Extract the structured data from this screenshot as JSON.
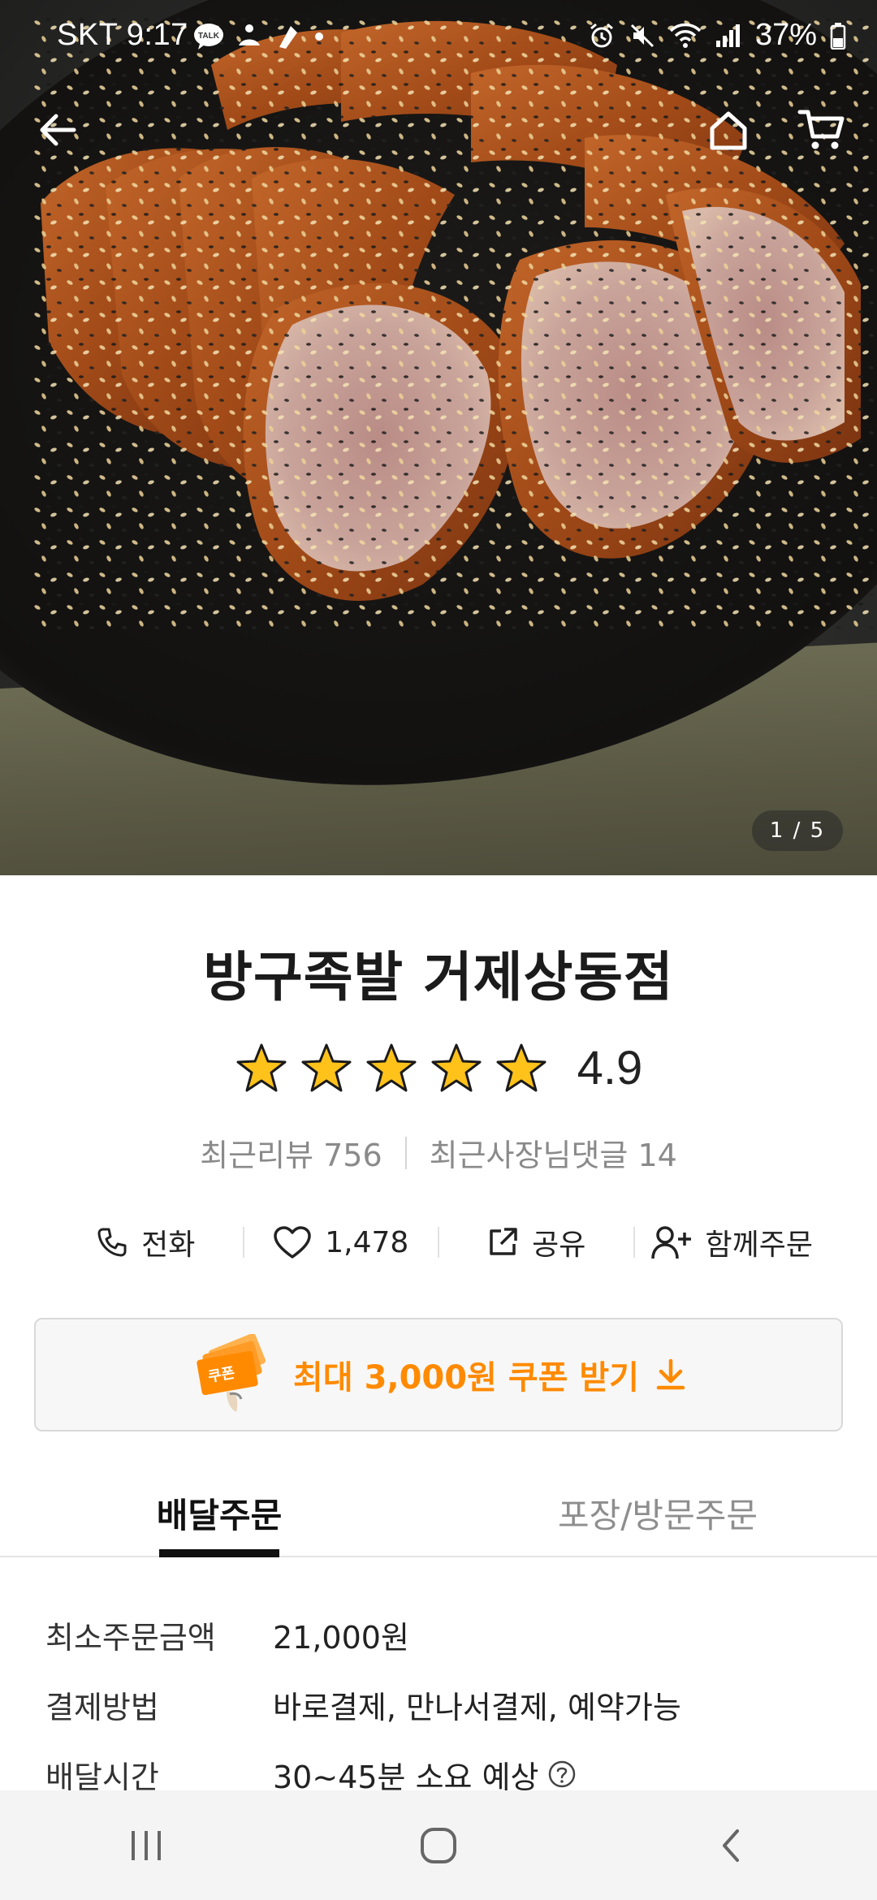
{
  "status_bar": {
    "carrier_time": "SKT 9:17",
    "battery": "37%",
    "talk_badge": "TALK"
  },
  "hero": {
    "page_indicator": "1 / 5"
  },
  "store": {
    "name": "방구족발 거제상동점",
    "rating": "4.9",
    "rating_stars": 5,
    "recent_reviews": "최근리뷰 756",
    "owner_replies": "최근사장님댓글 14"
  },
  "actions": {
    "call": "전화",
    "likes": "1,478",
    "share": "공유",
    "group_order": "함께주문"
  },
  "coupon": {
    "label": "최대 3,000원 쿠폰 받기",
    "badge": "쿠폰",
    "accent": "#ff8a00"
  },
  "tabs": [
    {
      "label": "배달주문",
      "active": true
    },
    {
      "label": "포장/방문주문",
      "active": false
    }
  ],
  "info": [
    {
      "label": "최소주문금액",
      "value": "21,000원"
    },
    {
      "label": "결제방법",
      "value": "바로결제, 만나서결제, 예약가능"
    },
    {
      "label": "배달시간",
      "value": "30~45분 소요 예상"
    }
  ]
}
